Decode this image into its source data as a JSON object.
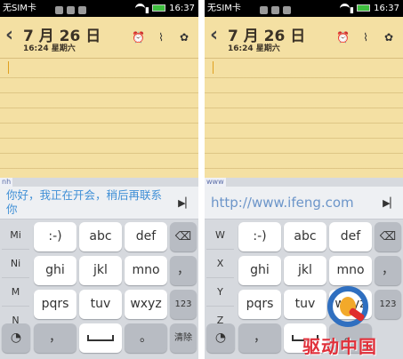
{
  "status": {
    "carrier": "无SIM卡",
    "time": "16:37"
  },
  "note": {
    "date": "7 月 26 日",
    "subtitle": "16:24 星期六",
    "icons": [
      "alarm-icon",
      "paperclip-icon",
      "palette-icon"
    ]
  },
  "left": {
    "composition": "nh",
    "candidate": "你好，我正在开会，稍后再联系你",
    "side_keys": [
      "Mi",
      "Ni",
      "M",
      "N"
    ],
    "rows": [
      [
        ":-)",
        "abc",
        "def"
      ],
      [
        "ghi",
        "jkl",
        "mno"
      ],
      [
        "pqrs",
        "tuv",
        "wxyz"
      ]
    ],
    "row2_right": "，",
    "row3_right": "123",
    "bottom": {
      "comma": "，",
      "period": "。",
      "clear": "清除"
    }
  },
  "right": {
    "composition": "www",
    "candidate": "http://www.ifeng.com",
    "side_keys": [
      "W",
      "X",
      "Y",
      "Z"
    ],
    "rows": [
      [
        ":-)",
        "abc",
        "def"
      ],
      [
        "ghi",
        "jkl",
        "mno"
      ],
      [
        "pqrs",
        "tuv",
        "wxyz"
      ]
    ],
    "row2_right": "，",
    "row3_right": "123",
    "bottom": {
      "comma": "，",
      "period": "。"
    }
  },
  "watermark": {
    "text": "驱动中国"
  }
}
